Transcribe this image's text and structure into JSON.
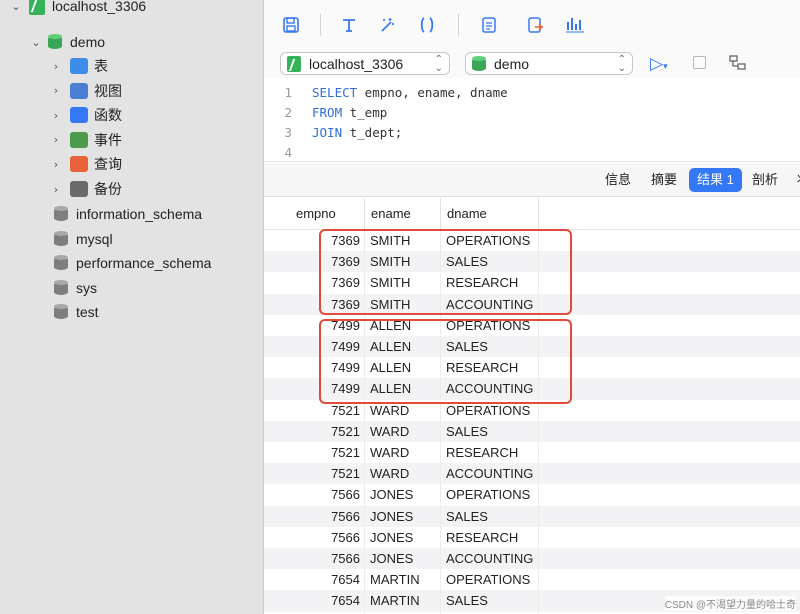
{
  "sidebar": {
    "connection": "localhost_3306",
    "database": "demo",
    "objects": [
      {
        "label": "表",
        "icon": "table-icon",
        "color": "#3d8ce8"
      },
      {
        "label": "视图",
        "icon": "view-icon",
        "color": "#4a7fd4"
      },
      {
        "label": "函数",
        "icon": "function-icon",
        "color": "#3478f6"
      },
      {
        "label": "事件",
        "icon": "event-icon",
        "color": "#4c9a4c"
      },
      {
        "label": "查询",
        "icon": "query-icon",
        "color": "#e8633a"
      },
      {
        "label": "备份",
        "icon": "backup-icon",
        "color": "#6a6a6a"
      }
    ],
    "other_databases": [
      "information_schema",
      "mysql",
      "performance_schema",
      "sys",
      "test"
    ]
  },
  "toolbar": {
    "icons": [
      "save-icon",
      "format-icon",
      "beautify-icon",
      "braces-icon",
      "text-icon",
      "export-icon",
      "explain-icon"
    ]
  },
  "selectors": {
    "connection": "localhost_3306",
    "database": "demo"
  },
  "editor": {
    "lines": [
      {
        "num": "1",
        "kw": "SELECT",
        "rest": " empno, ename, dname"
      },
      {
        "num": "2",
        "kw": "FROM",
        "rest": " t_emp"
      },
      {
        "num": "3",
        "kw": "JOIN",
        "rest": " t_dept;"
      },
      {
        "num": "4",
        "kw": "",
        "rest": ""
      }
    ]
  },
  "result_tabs": {
    "info": "信息",
    "summary": "摘要",
    "result": "结果 1",
    "profile": "剖析",
    "status": "状"
  },
  "grid": {
    "columns": [
      "empno",
      "ename",
      "dname"
    ],
    "rows": [
      [
        "7369",
        "SMITH",
        "OPERATIONS"
      ],
      [
        "7369",
        "SMITH",
        "SALES"
      ],
      [
        "7369",
        "SMITH",
        "RESEARCH"
      ],
      [
        "7369",
        "SMITH",
        "ACCOUNTING"
      ],
      [
        "7499",
        "ALLEN",
        "OPERATIONS"
      ],
      [
        "7499",
        "ALLEN",
        "SALES"
      ],
      [
        "7499",
        "ALLEN",
        "RESEARCH"
      ],
      [
        "7499",
        "ALLEN",
        "ACCOUNTING"
      ],
      [
        "7521",
        "WARD",
        "OPERATIONS"
      ],
      [
        "7521",
        "WARD",
        "SALES"
      ],
      [
        "7521",
        "WARD",
        "RESEARCH"
      ],
      [
        "7521",
        "WARD",
        "ACCOUNTING"
      ],
      [
        "7566",
        "JONES",
        "OPERATIONS"
      ],
      [
        "7566",
        "JONES",
        "SALES"
      ],
      [
        "7566",
        "JONES",
        "RESEARCH"
      ],
      [
        "7566",
        "JONES",
        "ACCOUNTING"
      ],
      [
        "7654",
        "MARTIN",
        "OPERATIONS"
      ],
      [
        "7654",
        "MARTIN",
        "SALES"
      ]
    ]
  },
  "watermark": "CSDN @不渴望力量的哈士奇",
  "colors": {
    "accent": "#3478f6",
    "highlight": "#e14b3d",
    "connection": "#36b35a"
  }
}
